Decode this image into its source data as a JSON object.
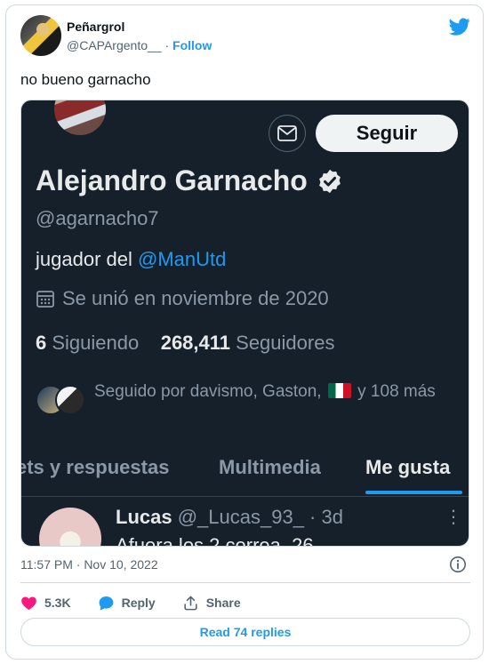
{
  "author": {
    "name": "Peñargrol",
    "handle": "@CAPArgento__",
    "separator": "·",
    "follow_label": "Follow"
  },
  "tweet": {
    "text": "no bueno garnacho",
    "timestamp": "11:57 PM · Nov 10, 2022"
  },
  "embedded_profile": {
    "follow_button": "Seguir",
    "name": "Alejandro Garnacho",
    "handle": "@agarnacho7",
    "bio_prefix": "jugador del ",
    "bio_mention": "@ManUtd",
    "joined": "Se unió en noviembre de 2020",
    "following_count": "6",
    "following_label": "Siguiendo",
    "followers_count": "268,411",
    "followers_label": "Seguidores",
    "followed_by_prefix": "Seguido por davismo, Gaston,",
    "followed_by_suffix": "y 108 más",
    "tabs": [
      "ets y respuestas",
      "Multimedia",
      "Me gusta"
    ],
    "active_tab": "Me gusta",
    "reply": {
      "name": "Lucas",
      "handle_time": "@_Lucas_93_ · 3d",
      "text": "Afuera los 2 correa. 26",
      "more": "⋮"
    }
  },
  "actions": {
    "like_count": "5.3K",
    "reply_label": "Reply",
    "share_label": "Share",
    "read_replies": "Read 74 replies"
  },
  "colors": {
    "accent": "#1d9bf0",
    "like": "#f91880",
    "dark_bg": "#15202b"
  }
}
